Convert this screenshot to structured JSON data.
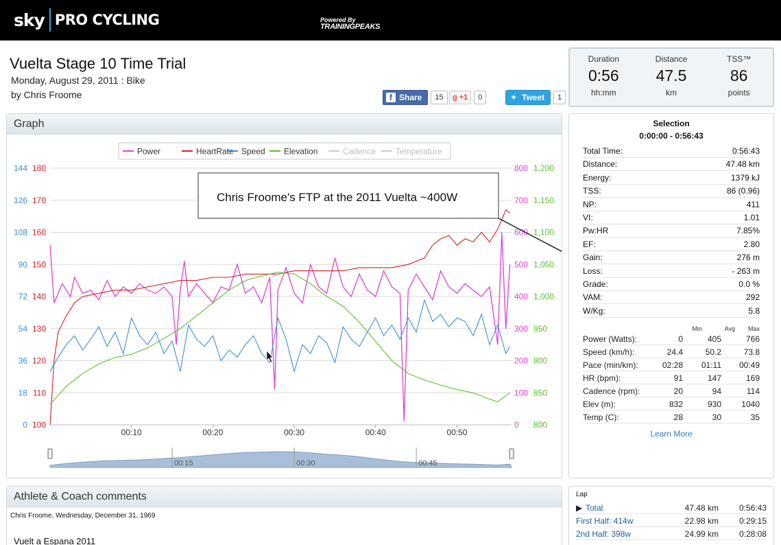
{
  "header": {
    "brand_sky": "sky",
    "brand_pro": "PRO CYCLING",
    "powered_by": "Powered By",
    "powered_name": "TRAININGPEAKS"
  },
  "workout": {
    "title": "Vuelta Stage 10 Time Trial",
    "date_line": "Monday, August 29, 2011 : Bike",
    "author": "by Chris Froome"
  },
  "social": {
    "fb_label": "Share",
    "fb_count": "15",
    "gplus_label": "+1",
    "gplus_count": "0",
    "tweet_label": "Tweet",
    "tweet_count": "1"
  },
  "summary": [
    {
      "label": "Duration",
      "value": "0:56",
      "unit": "hh:mm"
    },
    {
      "label": "Distance",
      "value": "47.5",
      "unit": "km"
    },
    {
      "label": "TSS™",
      "value": "86",
      "unit": "points"
    }
  ],
  "graph": {
    "panel_title": "Graph",
    "annotation": "Chris Froome's FTP at the 2011 Vuelta ~400W",
    "nav_ticks": [
      "00:15",
      "00:30",
      "00:45"
    ]
  },
  "chart_data": {
    "type": "line",
    "legend": [
      {
        "name": "Power",
        "color": "#e040d0",
        "enabled": true
      },
      {
        "name": "HeartRate",
        "color": "#d42020",
        "enabled": true
      },
      {
        "name": "Speed",
        "color": "#3d8fd6",
        "enabled": true
      },
      {
        "name": "Elevation",
        "color": "#5bbf2a",
        "enabled": true
      },
      {
        "name": "Cadence",
        "color": "#cccccc",
        "enabled": false
      },
      {
        "name": "Temperature",
        "color": "#cccccc",
        "enabled": false
      }
    ],
    "x_ticks": [
      "00:10",
      "00:20",
      "00:30",
      "00:40",
      "00:50"
    ],
    "x_tick_minutes": [
      10,
      20,
      30,
      40,
      50
    ],
    "xlim_minutes": [
      0,
      56.7
    ],
    "axes": {
      "speed": {
        "ticks": [
          "144",
          "126",
          "108",
          "90",
          "72",
          "54",
          "36",
          "18",
          "0"
        ],
        "color": "#3d8fd6",
        "ylim": [
          0,
          144
        ]
      },
      "heartrate": {
        "ticks": [
          "180",
          "170",
          "160",
          "150",
          "140",
          "130",
          "120",
          "110",
          "100"
        ],
        "color": "#d42020",
        "ylim": [
          100,
          180
        ]
      },
      "power": {
        "ticks": [
          "800",
          "700",
          "600",
          "500",
          "400",
          "300",
          "200",
          "100",
          "0"
        ],
        "color": "#e040d0",
        "ylim": [
          0,
          800
        ]
      },
      "elevation": {
        "ticks": [
          "1,200",
          "1,150",
          "1,100",
          "1,050",
          "1,000",
          "950",
          "900",
          "850",
          "800"
        ],
        "color": "#5bbf2a",
        "ylim": [
          800,
          1200
        ]
      }
    },
    "series": [
      {
        "name": "Power",
        "axis": "power",
        "x": [
          0,
          0.5,
          1.5,
          2.5,
          3,
          4,
          5,
          6,
          7,
          8,
          9,
          10,
          11,
          12,
          13,
          14,
          15,
          15.5,
          16,
          16.5,
          17,
          18,
          19,
          20,
          21,
          22,
          23,
          24,
          25,
          26,
          27,
          27.6,
          28,
          29,
          30,
          31,
          32,
          33,
          34,
          35,
          36,
          37,
          38,
          39,
          40,
          41,
          42,
          43,
          43.5,
          44,
          45,
          46,
          47,
          48,
          49,
          50,
          51,
          52,
          53,
          54,
          55,
          55.5,
          56,
          56.5
        ],
        "values": [
          560,
          380,
          440,
          400,
          460,
          410,
          420,
          390,
          450,
          400,
          430,
          410,
          440,
          420,
          410,
          430,
          400,
          250,
          420,
          510,
          400,
          440,
          410,
          380,
          430,
          420,
          500,
          410,
          430,
          380,
          460,
          110,
          420,
          490,
          410,
          380,
          500,
          430,
          410,
          520,
          430,
          400,
          470,
          420,
          400,
          480,
          430,
          410,
          10,
          420,
          470,
          430,
          390,
          480,
          430,
          410,
          440,
          420,
          400,
          430,
          250,
          600,
          300,
          500
        ]
      },
      {
        "name": "HeartRate",
        "axis": "heartrate",
        "x": [
          0,
          0.5,
          1,
          2,
          3,
          4,
          6,
          8,
          10,
          12,
          14,
          16,
          18,
          20,
          22,
          24,
          26,
          28,
          30,
          32,
          34,
          36,
          38,
          40,
          42,
          44,
          46,
          47,
          48,
          49,
          50,
          51,
          52,
          53,
          54,
          55,
          55.5,
          56,
          56.5
        ],
        "values": [
          100,
          120,
          129,
          134,
          138,
          140,
          141,
          142,
          142,
          143,
          144,
          145,
          145,
          146,
          146,
          147,
          147,
          147,
          148,
          148,
          148,
          148,
          149,
          149,
          149,
          150,
          152,
          156,
          158,
          159,
          156,
          158,
          157,
          160,
          157,
          161,
          164,
          167,
          166
        ]
      },
      {
        "name": "Speed",
        "axis": "speed",
        "x": [
          0,
          1,
          2,
          3,
          4,
          5,
          6,
          7,
          8,
          9,
          10,
          11,
          12,
          13,
          14,
          15,
          16,
          17,
          18,
          19,
          20,
          21,
          22,
          23,
          24,
          25,
          26,
          27,
          28,
          29,
          30,
          31,
          32,
          33,
          34,
          35,
          36,
          37,
          38,
          39,
          40,
          41,
          42,
          43,
          44,
          45,
          46,
          47,
          48,
          49,
          50,
          51,
          52,
          53,
          54,
          55,
          56,
          56.5
        ],
        "values": [
          30,
          38,
          45,
          50,
          42,
          48,
          55,
          44,
          52,
          40,
          60,
          50,
          45,
          52,
          40,
          47,
          30,
          56,
          48,
          44,
          50,
          36,
          42,
          38,
          45,
          50,
          40,
          35,
          60,
          48,
          30,
          45,
          40,
          50,
          46,
          35,
          55,
          48,
          44,
          52,
          60,
          50,
          56,
          48,
          60,
          52,
          70,
          58,
          62,
          55,
          60,
          58,
          50,
          62,
          45,
          56,
          40,
          44
        ]
      },
      {
        "name": "Elevation",
        "axis": "elevation",
        "x": [
          0,
          2,
          4,
          6,
          8,
          10,
          12,
          14,
          16,
          18,
          20,
          22,
          24,
          26,
          28,
          30,
          32,
          34,
          36,
          38,
          40,
          42,
          44,
          46,
          48,
          50,
          52,
          54,
          55,
          56.5
        ],
        "values": [
          832,
          860,
          880,
          895,
          905,
          910,
          920,
          935,
          950,
          970,
          990,
          1010,
          1025,
          1032,
          1038,
          1035,
          1020,
          1000,
          985,
          960,
          930,
          900,
          880,
          870,
          862,
          855,
          850,
          840,
          836,
          850
        ]
      }
    ]
  },
  "stats": {
    "title": "Selection",
    "range": "0:00:00 - 0:56:43",
    "rows": [
      {
        "label": "Total Time:",
        "value": "0:56:43"
      },
      {
        "label": "Distance:",
        "value": "47.48 km"
      },
      {
        "label": "Energy:",
        "value": "1379 kJ"
      },
      {
        "label": "TSS:",
        "value": "86 (0.96)"
      },
      {
        "label": "NP:",
        "value": "411"
      },
      {
        "label": "VI:",
        "value": "1.01"
      },
      {
        "label": "Pw:HR",
        "value": "7.85%"
      },
      {
        "label": "EF:",
        "value": "2.80"
      },
      {
        "label": "Gain:",
        "value": "276 m"
      },
      {
        "label": "Loss:",
        "value": "- 263 m"
      },
      {
        "label": "Grade:",
        "value": "0.0 %"
      },
      {
        "label": "VAM:",
        "value": "292"
      },
      {
        "label": "W/Kg:",
        "value": "5.8"
      }
    ],
    "mm_headers": [
      "Min",
      "Avg",
      "Max"
    ],
    "mm_rows": [
      {
        "label": "Power (Watts):",
        "min": "0",
        "avg": "405",
        "max": "766"
      },
      {
        "label": "Speed (km/h):",
        "min": "24.4",
        "avg": "50.2",
        "max": "73.8"
      },
      {
        "label": "Pace (min/km):",
        "min": "02:28",
        "avg": "01:11",
        "max": "00:49"
      },
      {
        "label": "HR (bpm):",
        "min": "91",
        "avg": "147",
        "max": "169"
      },
      {
        "label": "Cadence (rpm):",
        "min": "20",
        "avg": "94",
        "max": "114"
      },
      {
        "label": "Elev (m):",
        "min": "832",
        "avg": "930",
        "max": "1040"
      },
      {
        "label": "Temp (C):",
        "min": "28",
        "avg": "30",
        "max": "35"
      }
    ],
    "learn_more": "Learn More"
  },
  "comments": {
    "panel_title": "Athlete & Coach comments",
    "by_line": "Chris Froome, Wednesday, December 31, 1969",
    "text": "Vuelt a Espana 2011"
  },
  "laps": {
    "title": "Lap",
    "rows": [
      {
        "name": "Total",
        "distance": "47.48 km",
        "time": "0:56:43"
      },
      {
        "name": "First Half: 414w",
        "distance": "22.98 km",
        "time": "0:29:15"
      },
      {
        "name": "2nd Half: 398w",
        "distance": "24.99 km",
        "time": "0:28:08"
      }
    ]
  }
}
